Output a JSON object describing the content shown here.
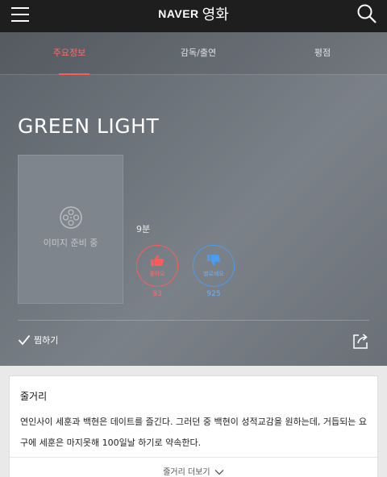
{
  "header": {
    "brand": "NAVER",
    "section": "영화"
  },
  "tabs": [
    {
      "label": "주요정보",
      "active": true
    },
    {
      "label": "감독/출연",
      "active": false
    },
    {
      "label": "평점",
      "active": false
    }
  ],
  "movie": {
    "title": "GREEN LIGHT",
    "poster_placeholder": "이미지 준비 중",
    "runtime": "9분"
  },
  "votes": {
    "like_label": "좋아요",
    "like_count": "93",
    "dislike_label": "별로예요",
    "dislike_count": "925"
  },
  "actions": {
    "wishlist_label": "찜하기"
  },
  "synopsis": {
    "title": "줄거리",
    "text": "연인사이 세훈과 백현은 데이트를 즐긴다. 그러던 중 백현이 성적교감을 원하는데, 거듭되는 요구에 세훈은 마지못해 100일날 하기로 약속한다.",
    "more_label": "줄거리 더보기"
  },
  "colors": {
    "accent_red": "#ff5a5a",
    "accent_blue": "#4a9cf0",
    "topbar": "#1e1e1e"
  }
}
